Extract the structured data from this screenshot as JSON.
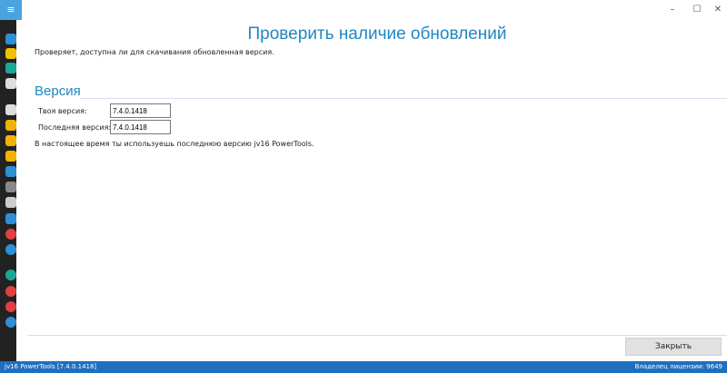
{
  "window": {
    "menu_icon": "hamburger-icon"
  },
  "sidebar": {
    "icons": [
      {
        "name": "home-icon",
        "color": "#2d8fd5"
      },
      {
        "name": "lightning-icon",
        "color": "#f2c200"
      },
      {
        "name": "check-icon",
        "color": "#1aa89a"
      },
      {
        "name": "search-icon",
        "color": "#dddddd"
      },
      {
        "name": "zoom-plus-icon",
        "color": "#dddddd"
      },
      {
        "name": "copy-icon",
        "color": "#f2b300"
      },
      {
        "name": "folder-icon",
        "color": "#f2b300"
      },
      {
        "name": "code-icon",
        "color": "#f2b300"
      },
      {
        "name": "merge-icon",
        "color": "#2d8fd5"
      },
      {
        "name": "trash-icon",
        "color": "#888888"
      },
      {
        "name": "shredder-icon",
        "color": "#cccccc"
      },
      {
        "name": "chart-icon",
        "color": "#2d8fd5"
      },
      {
        "name": "remove-icon",
        "color": "#e04040"
      },
      {
        "name": "globe-icon",
        "color": "#2d8fd5"
      },
      {
        "name": "user-icon",
        "color": "#1aa89a"
      },
      {
        "name": "clock-icon",
        "color": "#e04040"
      },
      {
        "name": "lifebuoy-icon",
        "color": "#e04040"
      },
      {
        "name": "gear-icon",
        "color": "#2d8fd5"
      }
    ]
  },
  "main": {
    "title": "Проверить наличие обновлений",
    "description": "Проверяет, доступна ли для скачивания обновленная версия.",
    "section": "Версия",
    "your_version_label": "Твоя версия:",
    "your_version": "7.4.0.1418",
    "latest_version_label": "Последняя версия:",
    "latest_version": "7.4.0.1418",
    "message": "В настоящее время ты используешь последнюю версию jv16 PowerTools.",
    "close_label": "Закрыть"
  },
  "status": {
    "left": "jv16 PowerTools [7.4.0.1418]",
    "right": "Владелец лицензии: 9649"
  }
}
